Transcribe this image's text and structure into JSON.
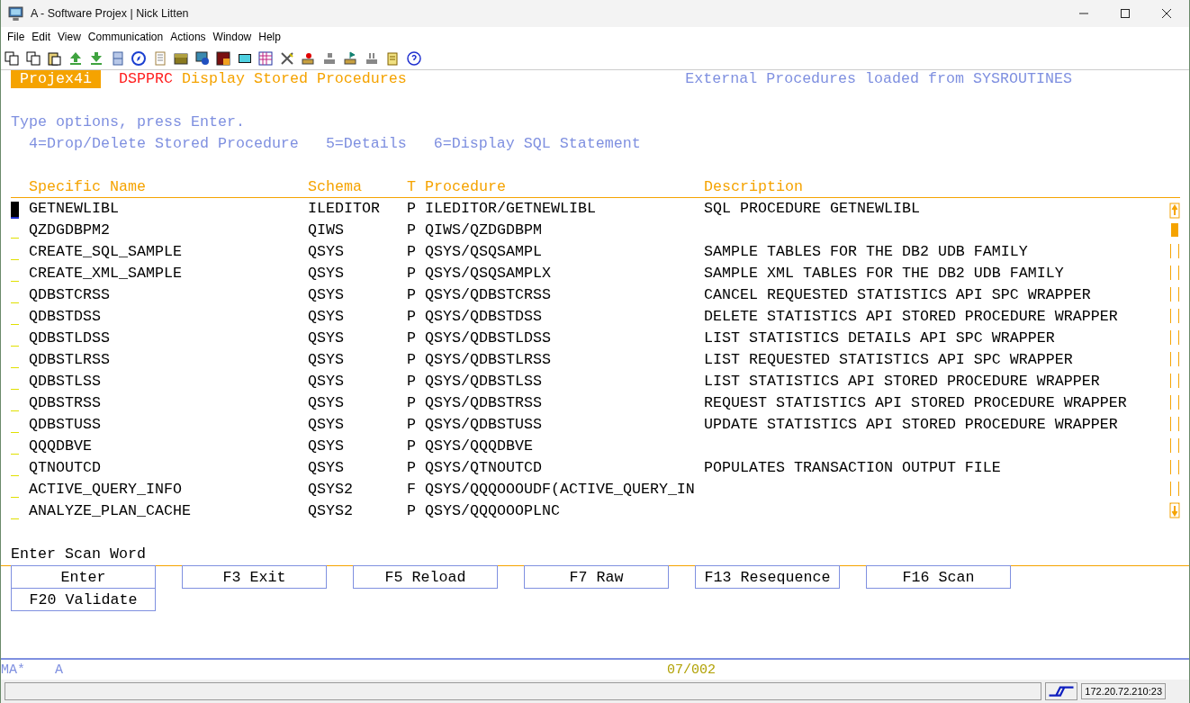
{
  "window": {
    "title": "A - Software Projex | Nick Litten"
  },
  "menu": [
    {
      "label": "File"
    },
    {
      "label": "Edit"
    },
    {
      "label": "View"
    },
    {
      "label": "Communication"
    },
    {
      "label": "Actions"
    },
    {
      "label": "Window"
    },
    {
      "label": "Help"
    }
  ],
  "screen": {
    "product": "Projex4i",
    "command": "DSPPRC",
    "heading": "Display Stored Procedures",
    "info": "External Procedures loaded from SYSROUTINES",
    "instruction": "Type options, press Enter.",
    "options": [
      "4=Drop/Delete Stored Procedure",
      "5=Details",
      "6=Display SQL Statement"
    ],
    "table": {
      "columns": [
        "Specific Name",
        "Schema",
        "T",
        "Procedure",
        "Description"
      ],
      "rows": [
        {
          "cursor": true,
          "cells": [
            "GETNEWLIBL",
            "ILEDITOR",
            "P",
            "ILEDITOR/GETNEWLIBL",
            "SQL PROCEDURE GETNEWLIBL"
          ]
        },
        {
          "cursor": false,
          "cells": [
            "QZDGDBPM2",
            "QIWS",
            "P",
            "QIWS/QZDGDBPM",
            ""
          ]
        },
        {
          "cursor": false,
          "cells": [
            "CREATE_SQL_SAMPLE",
            "QSYS",
            "P",
            "QSYS/QSQSAMPL",
            "SAMPLE TABLES FOR THE DB2 UDB FAMILY"
          ]
        },
        {
          "cursor": false,
          "cells": [
            "CREATE_XML_SAMPLE",
            "QSYS",
            "P",
            "QSYS/QSQSAMPLX",
            "SAMPLE XML TABLES FOR THE DB2 UDB FAMILY"
          ]
        },
        {
          "cursor": false,
          "cells": [
            "QDBSTCRSS",
            "QSYS",
            "P",
            "QSYS/QDBSTCRSS",
            "CANCEL REQUESTED STATISTICS API SPC WRAPPER"
          ]
        },
        {
          "cursor": false,
          "cells": [
            "QDBSTDSS",
            "QSYS",
            "P",
            "QSYS/QDBSTDSS",
            "DELETE STATISTICS API STORED PROCEDURE WRAPPER"
          ]
        },
        {
          "cursor": false,
          "cells": [
            "QDBSTLDSS",
            "QSYS",
            "P",
            "QSYS/QDBSTLDSS",
            "LIST STATISTICS DETAILS API SPC WRAPPER"
          ]
        },
        {
          "cursor": false,
          "cells": [
            "QDBSTLRSS",
            "QSYS",
            "P",
            "QSYS/QDBSTLRSS",
            "LIST REQUESTED STATISTICS API SPC WRAPPER"
          ]
        },
        {
          "cursor": false,
          "cells": [
            "QDBSTLSS",
            "QSYS",
            "P",
            "QSYS/QDBSTLSS",
            "LIST STATISTICS API STORED PROCEDURE WRAPPER"
          ]
        },
        {
          "cursor": false,
          "cells": [
            "QDBSTRSS",
            "QSYS",
            "P",
            "QSYS/QDBSTRSS",
            "REQUEST STATISTICS API STORED PROCEDURE WRAPPER"
          ]
        },
        {
          "cursor": false,
          "cells": [
            "QDBSTUSS",
            "QSYS",
            "P",
            "QSYS/QDBSTUSS",
            "UPDATE STATISTICS API STORED PROCEDURE WRAPPER"
          ]
        },
        {
          "cursor": false,
          "cells": [
            "QQQDBVE",
            "QSYS",
            "P",
            "QSYS/QQQDBVE",
            ""
          ]
        },
        {
          "cursor": false,
          "cells": [
            "QTNOUTCD",
            "QSYS",
            "P",
            "QSYS/QTNOUTCD",
            "POPULATES TRANSACTION OUTPUT FILE"
          ]
        },
        {
          "cursor": false,
          "cells": [
            "ACTIVE_QUERY_INFO",
            "QSYS2",
            "F",
            "QSYS/QQQOOOUDF(ACTIVE_QUERY_IN",
            ""
          ]
        },
        {
          "cursor": false,
          "cells": [
            "ANALYZE_PLAN_CACHE",
            "QSYS2",
            "P",
            "QSYS/QQQOOOPLNC",
            ""
          ]
        }
      ]
    },
    "prompt": "Enter Scan Word",
    "keys": [
      "Enter",
      "F3 Exit",
      "F5 Reload",
      "F7 Raw",
      "F13 Resequence",
      "F16 Scan",
      "F20 Validate"
    ]
  },
  "status_line": {
    "mode": "MA*",
    "session": "A",
    "position": "07/002"
  },
  "status_bar": {
    "host": "172.20.72.210:23"
  }
}
